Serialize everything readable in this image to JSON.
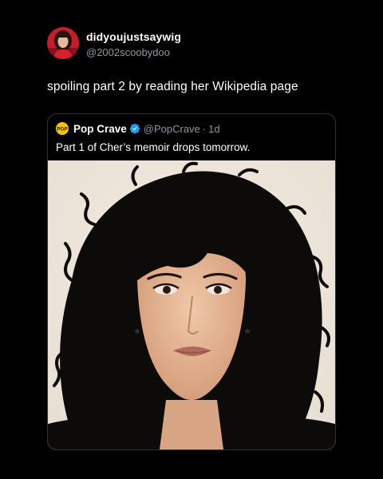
{
  "post": {
    "author": {
      "display_name": "didyoujustsaywig",
      "handle": "@2002scoobydoo"
    },
    "text": "spoiling part 2 by reading her Wikipedia page"
  },
  "quoted_post": {
    "author": {
      "display_name": "Pop Crave",
      "handle": "@PopCrave",
      "verified": true
    },
    "separator": "·",
    "time": "1d",
    "text": "Part 1 of Cher’s memoir drops tomorrow.",
    "avatar_text": "POP",
    "media": {
      "type": "photo"
    }
  },
  "colors": {
    "background": "#000000",
    "primary_text": "#ffffff",
    "secondary_text": "#8b98a5",
    "border": "#2f3336",
    "verified_badge": "#1d9bf0",
    "popcrave_yellow": "#f4c20d"
  }
}
